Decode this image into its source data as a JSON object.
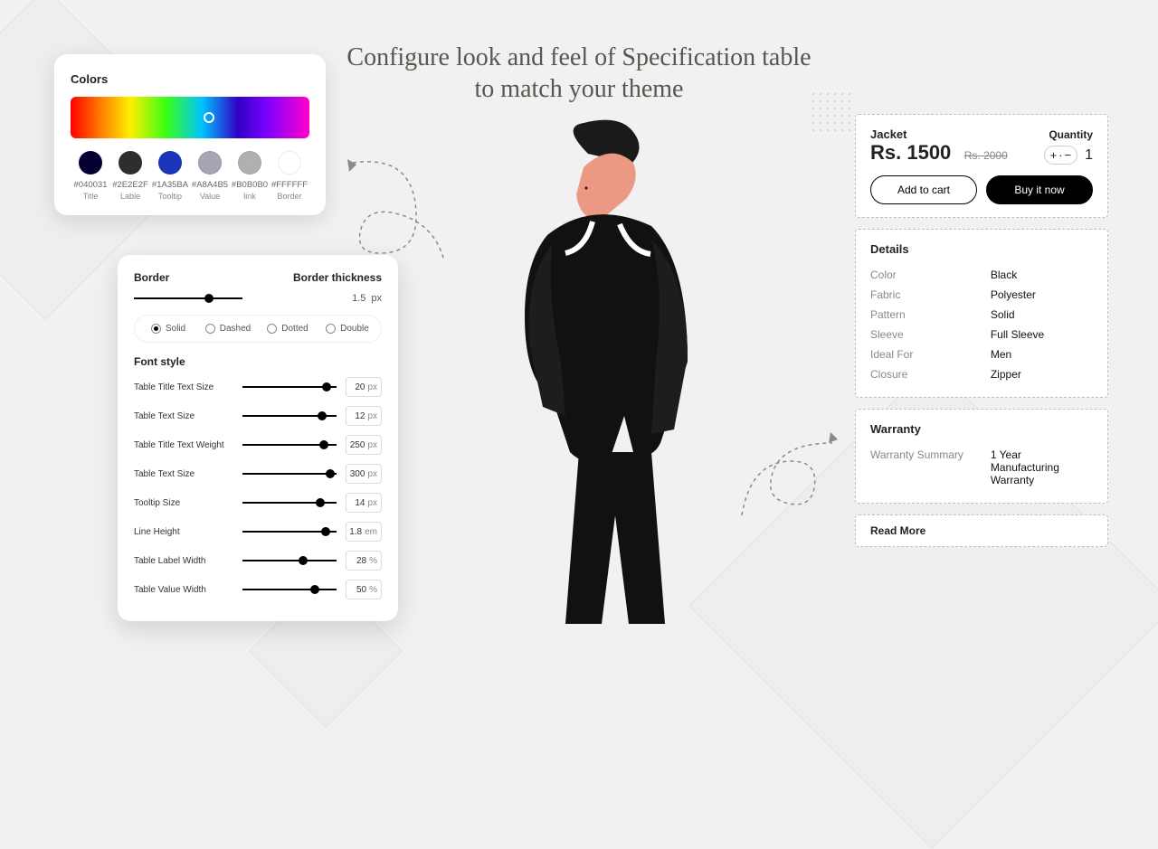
{
  "title_line": "Configure look and feel of Specification table to match your theme",
  "colors_panel": {
    "heading": "Colors",
    "gradient_cursor_pct": 58,
    "swatches": [
      {
        "hex": "#040031",
        "role": "Title"
      },
      {
        "hex": "#2E2E2F",
        "role": "Lable"
      },
      {
        "hex": "#1A35BA",
        "role": "Tooltip"
      },
      {
        "hex": "#A8A4B5",
        "role": "Value"
      },
      {
        "hex": "#B0B0B0",
        "role": "link"
      },
      {
        "hex": "#FFFFFF",
        "role": "Border"
      }
    ]
  },
  "border_panel": {
    "border_label": "Border",
    "thickness_label": "Border thickness",
    "thickness_value": "1.5",
    "thickness_unit": "px",
    "styles": [
      "Solid",
      "Dashed",
      "Dotted",
      "Double"
    ],
    "selected_style": "Solid",
    "font_heading": "Font style",
    "font_rows": [
      {
        "label": "Table Title Text Size",
        "value": "20",
        "unit": "px",
        "knob": 85
      },
      {
        "label": "Table Text Size",
        "value": "12",
        "unit": "px",
        "knob": 80
      },
      {
        "label": "Table Title Text Weight",
        "value": "250",
        "unit": "px",
        "knob": 82
      },
      {
        "label": "Table Text Size",
        "value": "300",
        "unit": "px",
        "knob": 88
      },
      {
        "label": "Tooltip Size",
        "value": "14",
        "unit": "px",
        "knob": 78
      },
      {
        "label": "Line Height",
        "value": "1.8",
        "unit": "em",
        "knob": 84
      },
      {
        "label": "Table Label Width",
        "value": "28",
        "unit": "%",
        "knob": 60
      },
      {
        "label": "Table Value Width",
        "value": "50",
        "unit": "%",
        "knob": 72
      }
    ]
  },
  "product": {
    "name": "Jacket",
    "quantity_label": "Quantity",
    "price": "Rs. 1500",
    "compare_price": "Rs. 2000",
    "qty": "1",
    "add_label": "Add to cart",
    "buy_label": "Buy it now",
    "details": {
      "title": "Details",
      "rows": [
        {
          "k": "Color",
          "v": "Black"
        },
        {
          "k": "Fabric",
          "v": "Polyester"
        },
        {
          "k": "Pattern",
          "v": "Solid"
        },
        {
          "k": "Sleeve",
          "v": "Full Sleeve"
        },
        {
          "k": "Ideal For",
          "v": "Men"
        },
        {
          "k": "Closure",
          "v": "Zipper"
        }
      ]
    },
    "warranty": {
      "title": "Warranty",
      "label": "Warranty Summary",
      "value": "1 Year Manufacturing Warranty"
    },
    "readmore": "Read More"
  }
}
